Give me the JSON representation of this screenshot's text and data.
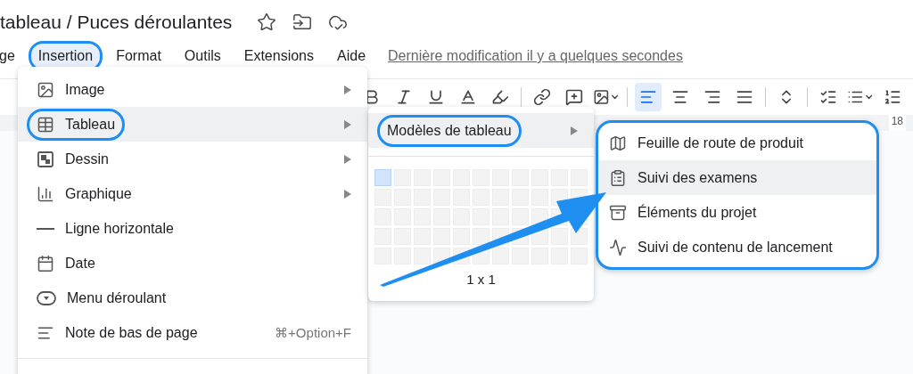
{
  "document": {
    "title": "tableau / Puces déroulantes"
  },
  "menubar": {
    "items": [
      {
        "label": "ge",
        "selected": false,
        "circled": false
      },
      {
        "label": "Insertion",
        "selected": true,
        "circled": true
      },
      {
        "label": "Format",
        "selected": false,
        "circled": false
      },
      {
        "label": "Outils",
        "selected": false,
        "circled": false
      },
      {
        "label": "Extensions",
        "selected": false,
        "circled": false
      },
      {
        "label": "Aide",
        "selected": false,
        "circled": false
      }
    ],
    "last_edit": "Dernière modification il y a quelques secondes"
  },
  "toolbar": {
    "groups": [
      [
        {
          "kind": "bold"
        },
        {
          "kind": "italic"
        },
        {
          "kind": "underline"
        },
        {
          "kind": "text-color"
        },
        {
          "kind": "highlight"
        }
      ],
      [
        {
          "kind": "link"
        },
        {
          "kind": "comment"
        },
        {
          "kind": "image"
        }
      ],
      [
        {
          "kind": "align-left",
          "selected": true
        },
        {
          "kind": "align-center",
          "selected": false
        },
        {
          "kind": "align-right",
          "selected": false
        },
        {
          "kind": "align-justify",
          "selected": false
        }
      ],
      [
        {
          "kind": "line-spacing"
        }
      ],
      [
        {
          "kind": "checklist"
        },
        {
          "kind": "bullets"
        },
        {
          "kind": "numbered"
        }
      ]
    ],
    "ruler_mark": "18"
  },
  "insert_menu": {
    "items": [
      {
        "kind": "image",
        "label": "Image",
        "submenu": true,
        "selected": false,
        "circled": false
      },
      {
        "kind": "table",
        "label": "Tableau",
        "submenu": true,
        "selected": true,
        "circled": true
      },
      {
        "kind": "drawing",
        "label": "Dessin",
        "submenu": true,
        "selected": false,
        "circled": false
      },
      {
        "kind": "chart",
        "label": "Graphique",
        "submenu": true,
        "selected": false,
        "circled": false
      },
      {
        "kind": "line",
        "label": "Ligne horizontale",
        "submenu": false,
        "selected": false,
        "circled": false
      },
      {
        "kind": "date",
        "label": "Date",
        "submenu": false,
        "selected": false,
        "circled": false
      },
      {
        "kind": "dropdown",
        "label": "Menu déroulant",
        "submenu": false,
        "selected": false,
        "circled": false
      },
      {
        "kind": "footnote",
        "label": "Note de bas de page",
        "submenu": false,
        "shortcut": "⌘+Option+F",
        "selected": false,
        "circled": false
      }
    ]
  },
  "table_menu": {
    "templates_item": {
      "label": "Modèles de tableau",
      "selected": true,
      "circled": true
    },
    "size_label": "1 x 1"
  },
  "templates_menu": {
    "circled": true,
    "items": [
      {
        "kind": "map",
        "label": "Feuille de route de produit",
        "selected": false
      },
      {
        "kind": "clipboard",
        "label": "Suivi des examens",
        "selected": true
      },
      {
        "kind": "archive",
        "label": "Éléments du projet",
        "selected": false
      },
      {
        "kind": "trend",
        "label": "Suivi de contenu de lancement",
        "selected": false
      }
    ]
  }
}
